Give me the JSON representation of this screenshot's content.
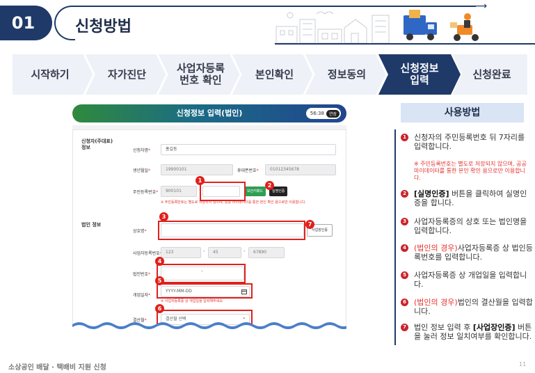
{
  "header": {
    "number": "01",
    "title": "신청방법"
  },
  "steps": [
    {
      "label": "시작하기",
      "active": false
    },
    {
      "label": "자가진단",
      "active": false
    },
    {
      "label": "사업자등록\n번호 확인",
      "active": false
    },
    {
      "label": "본인확인",
      "active": false
    },
    {
      "label": "정보동의",
      "active": false
    },
    {
      "label": "신청정보\n입력",
      "active": true
    },
    {
      "label": "신청완료",
      "active": false
    }
  ],
  "colors": {
    "primary": "#1f3a68",
    "marker": "#e0201b",
    "step_bg": "#eef1f7"
  },
  "form": {
    "title": "신청정보 입력(법인)",
    "timer": "56:38",
    "timer_button": "연장",
    "section_applicant": "신청자(주대표)\n정보",
    "section_corp": "법인 정보",
    "name_label": "신청자명",
    "name_value": "홍길동",
    "birth_label": "생년월일",
    "birth_value": "19900101",
    "phone_label": "휴대폰번호",
    "phone_value": "01012345678",
    "rrn_label": "주민등록번호",
    "rrn_front": "900101",
    "keypad_button": "보안키패드",
    "verify_button": "실명인증",
    "rrn_note": "※ 주민등록번호는 별도로 저장되지 않으며, 공공 마이데이터를 통한 본인 확인 용으로만 이용합니다.",
    "corp_name_label": "상호명",
    "biz_num_label": "사업자등록번호",
    "biz_num": [
      "123",
      "45",
      "67890"
    ],
    "corp_num_label": "법인번호",
    "open_date_label": "개업일자",
    "open_date_placeholder": "YYYY-MM-DD",
    "open_date_note": "※ 사업자등록증 상 개업일을 입력해주세요.",
    "settle_label": "결산월",
    "settle_placeholder": "결산월 선택",
    "biz_cert_button": "사업장인증",
    "markers": [
      "1",
      "2",
      "3",
      "4",
      "5",
      "6",
      "7"
    ]
  },
  "usage": {
    "title": "사용방법",
    "items": [
      {
        "num": "1",
        "text": "신청자의 주민등록번호 뒤 7자리를 입력합니다."
      },
      {
        "num": "2",
        "bold": "[실명인증]",
        "text": " 버튼을 클릭하여 실명인증을 합니다."
      },
      {
        "num": "3",
        "text": "사업자등록증의 상호 또는 법인명을 입력합니다."
      },
      {
        "num": "4",
        "red": "(법인의 경우)",
        "text": "사업자등록증 상 법인등록번호를 입력합니다."
      },
      {
        "num": "5",
        "text": "사업자등록증 상 개업일을 입력합니다."
      },
      {
        "num": "6",
        "red": "(법인의 경우)",
        "text": "법인의 결산월을 입력합니다."
      },
      {
        "num": "7",
        "pre": "법인 정보 입력 후 ",
        "bold": "[사업장인증]",
        "text": " 버튼을 눌러 정보 일치여부를 확인합니다."
      }
    ],
    "note": "※ 주민등록번호는 별도로 저장되지 않으며, 공공 마이데이터를 통한 본인 확인 용으로만 이용합니다."
  },
  "footer": {
    "text": "소상공인 배달 · 택배비 지원 신청",
    "page": "11"
  }
}
